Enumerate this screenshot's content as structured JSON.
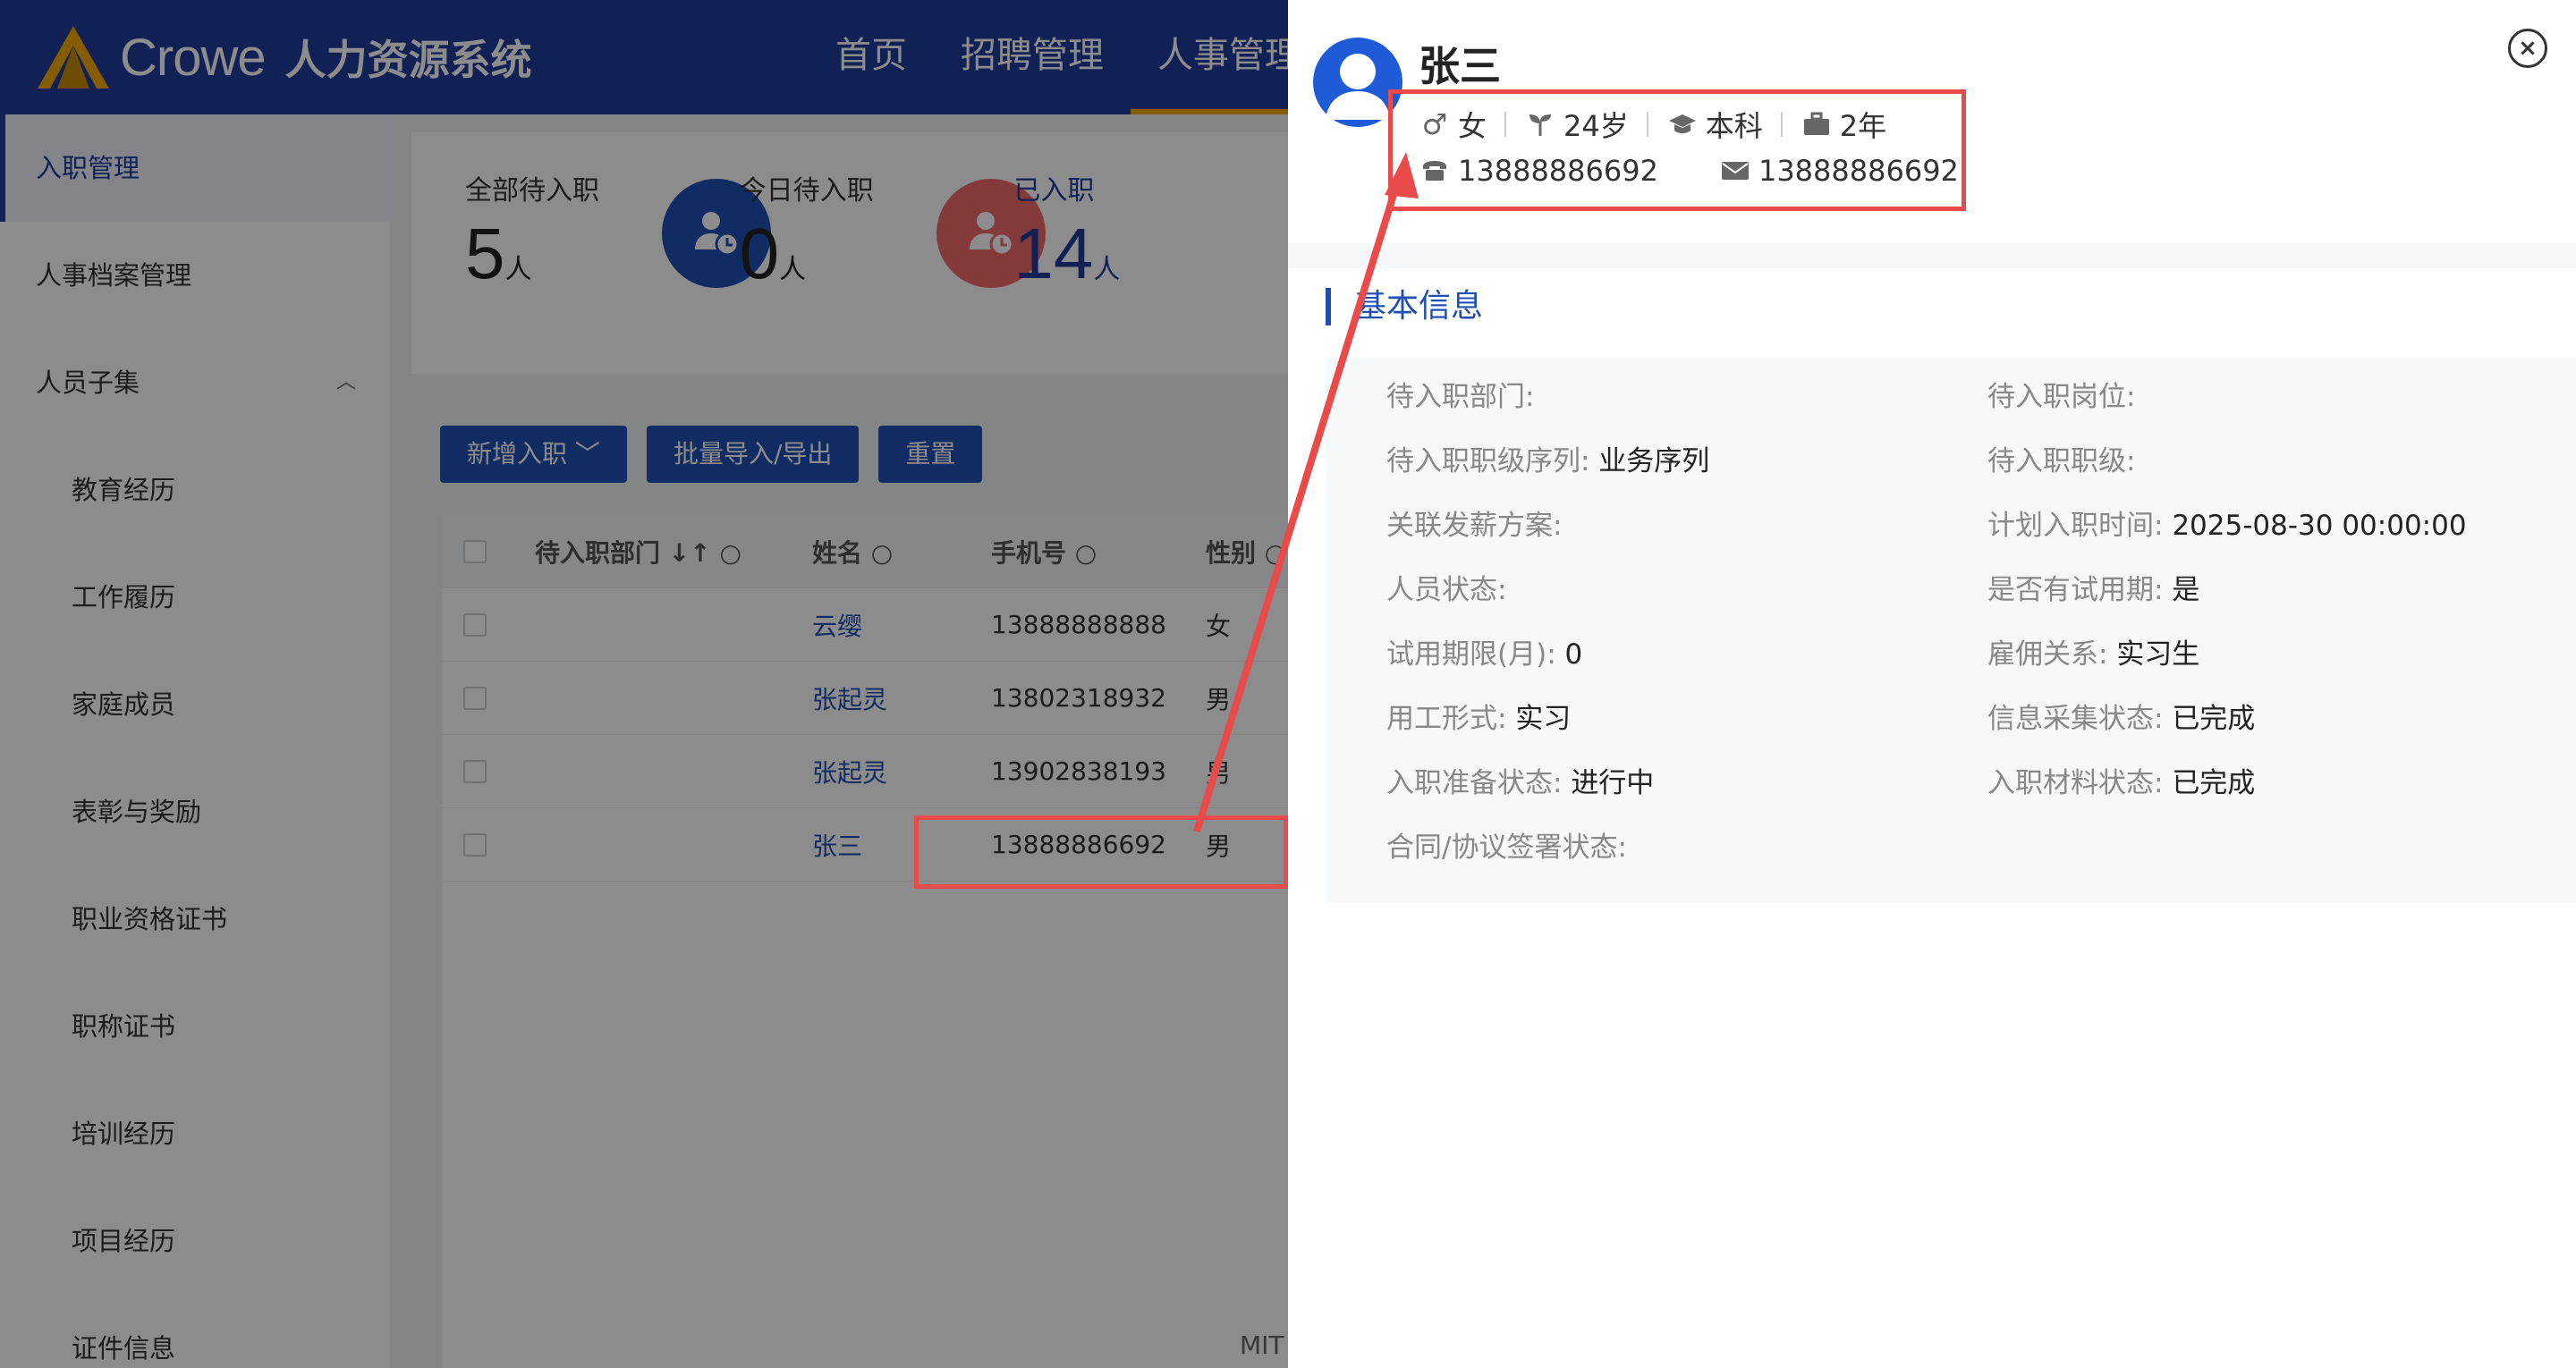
{
  "app": {
    "logo_text": "Crowe",
    "logo_sub": "人力资源系统",
    "nav": [
      {
        "label": "首页"
      },
      {
        "label": "招聘管理"
      },
      {
        "label": "人事管理"
      }
    ],
    "brand_color": "#1f3d9c",
    "accent_color": "#f2a900"
  },
  "sidebar": {
    "items": [
      {
        "label": "入职管理",
        "active": true
      },
      {
        "label": "人事档案管理"
      },
      {
        "label": "人员子集",
        "expanded": true
      },
      {
        "label": "教育经历"
      },
      {
        "label": "工作履历"
      },
      {
        "label": "家庭成员"
      },
      {
        "label": "表彰与奖励"
      },
      {
        "label": "职业资格证书"
      },
      {
        "label": "职称证书"
      },
      {
        "label": "培训经历"
      },
      {
        "label": "项目经历"
      },
      {
        "label": "证件信息"
      }
    ]
  },
  "stats": [
    {
      "label": "全部待入职",
      "value": "5",
      "unit": "人"
    },
    {
      "label": "今日待入职",
      "value": "0",
      "unit": "人"
    },
    {
      "label": "已入职",
      "value": "14",
      "unit": "人"
    }
  ],
  "toolbar": {
    "add_label": "新增入职",
    "import_label": "批量导入/导出",
    "reset_label": "重置"
  },
  "table": {
    "headers": [
      "待入职部门",
      "姓名",
      "手机号",
      "性别"
    ],
    "rows": [
      {
        "dept": "",
        "name": "云缨",
        "phone": "13888888888",
        "gender": "女"
      },
      {
        "dept": "",
        "name": "张起灵",
        "phone": "13802318932",
        "gender": "男"
      },
      {
        "dept": "",
        "name": "张起灵",
        "phone": "13902838193",
        "gender": "男"
      },
      {
        "dept": "",
        "name": "张三",
        "phone": "13888886692",
        "gender": "男"
      }
    ]
  },
  "footer_text": "MIT",
  "drawer": {
    "name": "张三",
    "gender": "女",
    "age": "24岁",
    "education": "本科",
    "experience": "2年",
    "phone": "13888886692",
    "email": "13888886692",
    "section_title": "基本信息",
    "fields": {
      "dept": {
        "label": "待入职部门:",
        "value": ""
      },
      "post": {
        "label": "待入职岗位:",
        "value": ""
      },
      "grade_seq": {
        "label": "待入职职级序列:",
        "value": "业务序列"
      },
      "grade": {
        "label": "待入职职级:",
        "value": ""
      },
      "salary_plan": {
        "label": "关联发薪方案:",
        "value": ""
      },
      "plan_time": {
        "label": "计划入职时间:",
        "value": "2025-08-30 00:00:00"
      },
      "status": {
        "label": "人员状态:",
        "value": ""
      },
      "probation": {
        "label": "是否有试用期:",
        "value": "是"
      },
      "probation_months": {
        "label": "试用期限(月):",
        "value": "0"
      },
      "employ_rel": {
        "label": "雇佣关系:",
        "value": "实习生"
      },
      "work_form": {
        "label": "用工形式:",
        "value": "实习"
      },
      "info_status": {
        "label": "信息采集状态:",
        "value": "已完成"
      },
      "prep_status": {
        "label": "入职准备状态:",
        "value": "进行中"
      },
      "material_status": {
        "label": "入职材料状态:",
        "value": "已完成"
      },
      "contract_status": {
        "label": "合同/协议签署状态:",
        "value": ""
      }
    }
  },
  "annotation_color": "#e94a4a"
}
